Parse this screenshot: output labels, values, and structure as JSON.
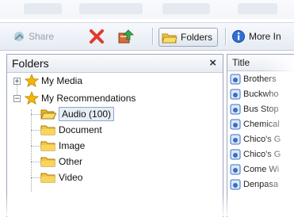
{
  "toolbar": {
    "share_label": "Share",
    "folders_label": "Folders",
    "more_label": "More In"
  },
  "folders_panel": {
    "title": "Folders",
    "close_symbol": "×",
    "tree": {
      "my_media": "My Media",
      "my_recommendations": "My Recommendations",
      "children": [
        "Audio (100)",
        "Document",
        "Image",
        "Other",
        "Video"
      ]
    }
  },
  "list_panel": {
    "column_title": "Title",
    "items": [
      "Brothers",
      "Buckwho",
      "Bus Stop",
      "Chemical",
      "Chico's G",
      "Chico's G",
      "Come Wi",
      "Denpasa"
    ]
  },
  "colors": {
    "folder": "#f3c53b",
    "star": "#f2b705",
    "delete_x": "#e23a2c",
    "accent_border": "#9aa7bb"
  }
}
